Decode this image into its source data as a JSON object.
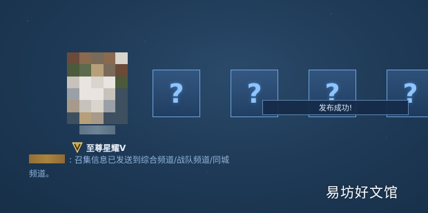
{
  "rank": {
    "icon": "rank-v-shield-icon",
    "label": "至尊星耀V"
  },
  "slots": [
    {
      "icon": "question-mark-icon",
      "symbol": "?"
    },
    {
      "icon": "question-mark-icon",
      "symbol": "?"
    },
    {
      "icon": "question-mark-icon",
      "symbol": "?"
    },
    {
      "icon": "question-mark-icon",
      "symbol": "?"
    }
  ],
  "toast": {
    "text": "发布成功!"
  },
  "chat": {
    "line1": ": 召集信息已发送到综合频道/战队频道/同城",
    "line2": "频道。"
  },
  "watermark": {
    "text": "易坊好文馆"
  },
  "colors": {
    "accent": "#6fa7df",
    "chat_text": "#8fb3dc",
    "background": "#1f3b58"
  }
}
